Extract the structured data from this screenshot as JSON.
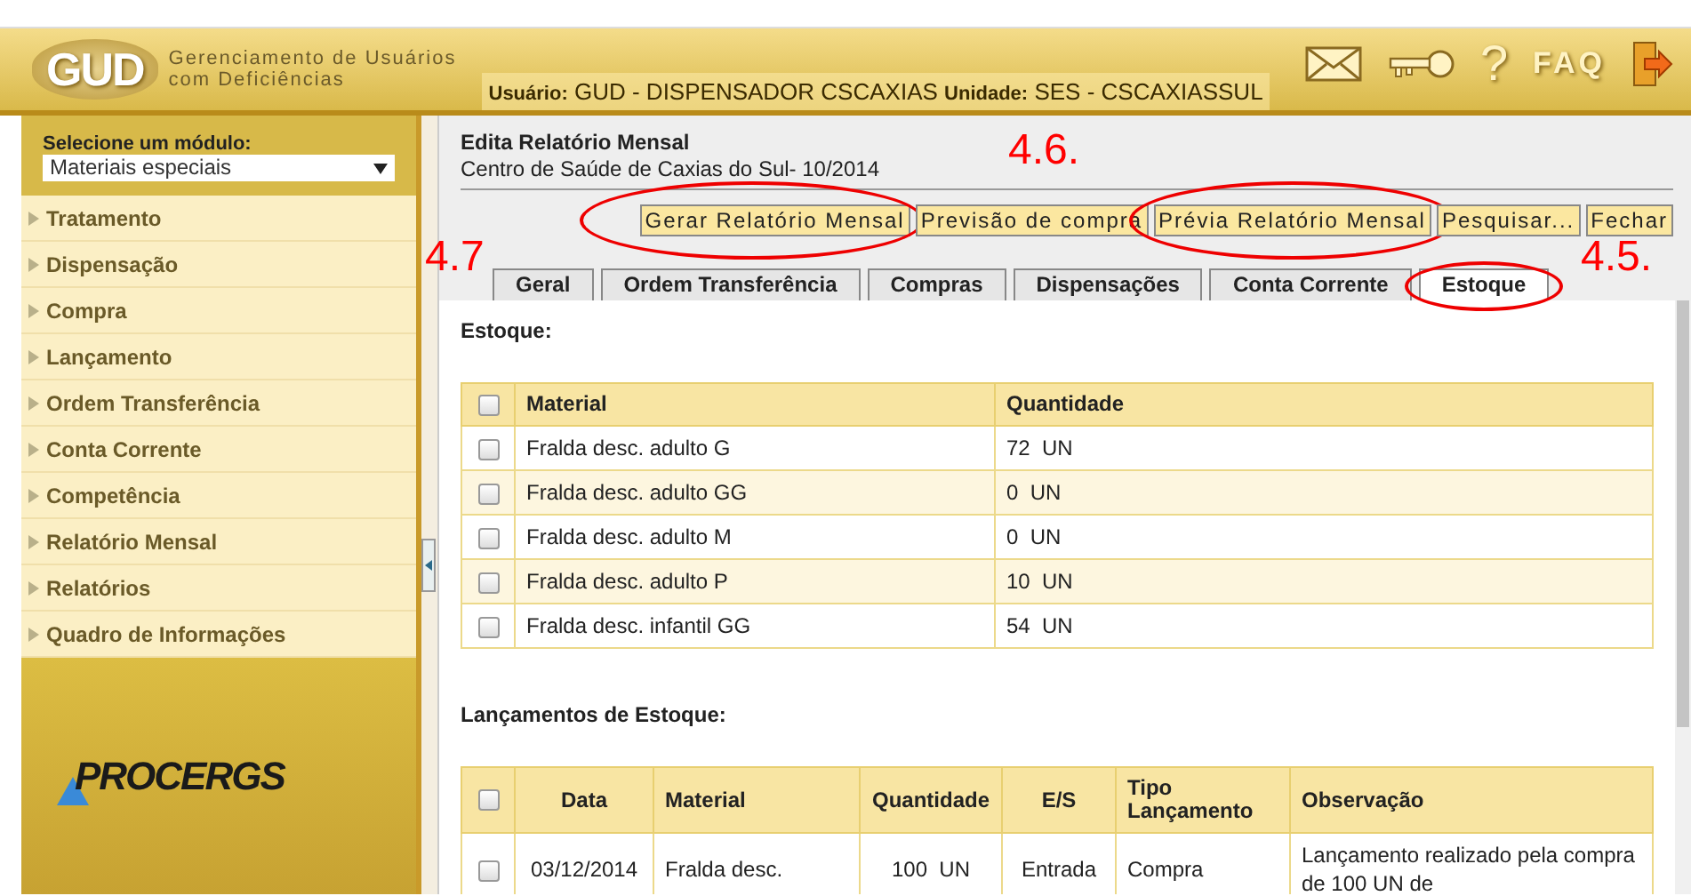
{
  "header": {
    "logo": "GUD",
    "app_name_lines": [
      "Gerenciamento de Usuários",
      "com Deficiências"
    ],
    "user_label": "Usuário:",
    "user": "GUD - DISPENSADOR CSCAXIAS",
    "unit_label": "Unidade:",
    "unit": "SES - CSCAXIASSUL",
    "help": "?",
    "faq": "FAQ"
  },
  "sidebar": {
    "module_label": "Selecione um módulo:",
    "module_value": "Materiais especiais",
    "items": [
      "Tratamento",
      "Dispensação",
      "Compra",
      "Lançamento",
      "Ordem Transferência",
      "Conta Corrente",
      "Competência",
      "Relatório Mensal",
      "Relatórios",
      "Quadro de Informações"
    ],
    "footer_logo": "PROCERGS"
  },
  "main": {
    "title": "Edita Relatório Mensal",
    "subtitle": "Centro de Saúde de Caxias do Sul- 10/2014",
    "buttons": [
      {
        "label": "Gerar Relatório Mensal",
        "circled": true
      },
      {
        "label": "Previsão de compra",
        "circled": false
      },
      {
        "label": "Prévia Relatório Mensal",
        "circled": true
      },
      {
        "label": "Pesquisar...",
        "circled": false
      },
      {
        "label": "Fechar",
        "circled": false
      }
    ],
    "tabs": [
      {
        "label": "Geral",
        "selected": false,
        "circled": false
      },
      {
        "label": "Ordem Transferência",
        "selected": false,
        "circled": false
      },
      {
        "label": "Compras",
        "selected": false,
        "circled": false
      },
      {
        "label": "Dispensações",
        "selected": false,
        "circled": false
      },
      {
        "label": "Conta Corrente",
        "selected": false,
        "circled": false
      },
      {
        "label": "Estoque",
        "selected": true,
        "circled": true
      }
    ],
    "stock": {
      "heading": "Estoque:",
      "all_checked": false,
      "columns": [
        "Material",
        "Quantidade"
      ],
      "rows": [
        {
          "checked": false,
          "material": "Fralda desc. adulto G",
          "quantity": "72  UN"
        },
        {
          "checked": false,
          "material": "Fralda desc. adulto GG",
          "quantity": "0  UN"
        },
        {
          "checked": false,
          "material": "Fralda desc. adulto M",
          "quantity": "0  UN"
        },
        {
          "checked": false,
          "material": "Fralda desc. adulto P",
          "quantity": "10  UN"
        },
        {
          "checked": false,
          "material": "Fralda desc. infantil GG",
          "quantity": "54  UN"
        }
      ]
    },
    "entries": {
      "heading": "Lançamentos de Estoque:",
      "all_checked": false,
      "columns": [
        "Data",
        "Material",
        "Quantidade",
        "E/S",
        "Tipo Lançamento",
        "Observação"
      ],
      "rows": [
        {
          "checked": false,
          "cells": [
            "03/12/2014",
            "Fralda desc.",
            "100  UN",
            "Entrada",
            "Compra",
            "Lançamento realizado pela compra de 100 UN de"
          ]
        }
      ]
    }
  },
  "annotations": [
    {
      "label": "4.6."
    },
    {
      "label": "4.7"
    },
    {
      "label": "4.5."
    }
  ]
}
